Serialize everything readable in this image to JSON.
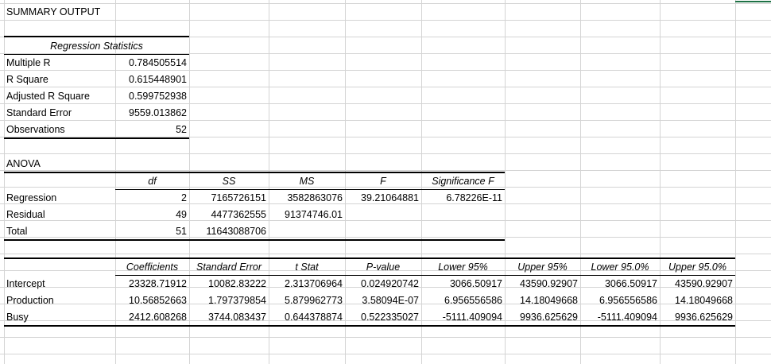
{
  "title": "SUMMARY OUTPUT",
  "regression_statistics": {
    "header": "Regression Statistics",
    "rows": [
      {
        "label": "Multiple R",
        "value": "0.784505514"
      },
      {
        "label": "R Square",
        "value": "0.615448901"
      },
      {
        "label": "Adjusted R Square",
        "value": "0.599752938"
      },
      {
        "label": "Standard Error",
        "value": "9559.013862"
      },
      {
        "label": "Observations",
        "value": "52"
      }
    ]
  },
  "anova": {
    "title": "ANOVA",
    "headers": [
      "df",
      "SS",
      "MS",
      "F",
      "Significance F"
    ],
    "rows": [
      {
        "label": "Regression",
        "df": "2",
        "ss": "7165726151",
        "ms": "3582863076",
        "f": "39.21064881",
        "sig_f": "6.78226E-11"
      },
      {
        "label": "Residual",
        "df": "49",
        "ss": "4477362555",
        "ms": "91374746.01",
        "f": "",
        "sig_f": ""
      },
      {
        "label": "Total",
        "df": "51",
        "ss": "11643088706",
        "ms": "",
        "f": "",
        "sig_f": ""
      }
    ]
  },
  "coefficients": {
    "headers": [
      "Coefficients",
      "Standard Error",
      "t Stat",
      "P-value",
      "Lower 95%",
      "Upper 95%",
      "Lower 95.0%",
      "Upper 95.0%"
    ],
    "rows": [
      {
        "label": "Intercept",
        "values": [
          "23328.71912",
          "10082.83222",
          "2.313706964",
          "0.024920742",
          "3066.50917",
          "43590.92907",
          "3066.50917",
          "43590.92907"
        ]
      },
      {
        "label": "Production",
        "values": [
          "10.56852663",
          "1.797379854",
          "5.879962773",
          "3.58094E-07",
          "6.956556586",
          "14.18049668",
          "6.956556586",
          "14.18049668"
        ]
      },
      {
        "label": "Busy",
        "values": [
          "2412.608268",
          "3744.083437",
          "0.644378874",
          "0.522335027",
          "-5111.409094",
          "9936.625629",
          "-5111.409094",
          "9936.625629"
        ]
      }
    ]
  },
  "colors": {
    "gridline": "#d4d4d4",
    "border": "#000000",
    "accent": "#1e7145"
  }
}
